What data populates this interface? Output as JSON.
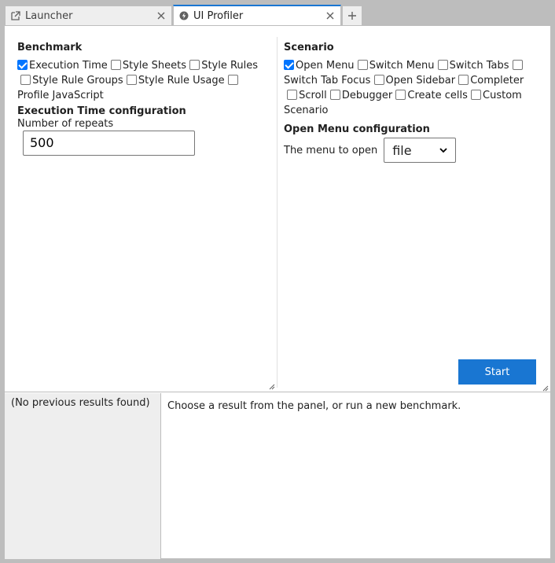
{
  "tabs": [
    {
      "label": "Launcher",
      "icon": "launch-icon",
      "active": false
    },
    {
      "label": "UI Profiler",
      "icon": "lightning-icon",
      "active": true
    }
  ],
  "benchmark": {
    "heading": "Benchmark",
    "options": [
      {
        "label": "Execution Time",
        "checked": true
      },
      {
        "label": "Style Sheets",
        "checked": false
      },
      {
        "label": "Style Rules",
        "checked": false
      },
      {
        "label": "Style Rule Groups",
        "checked": false
      },
      {
        "label": "Style Rule Usage",
        "checked": false
      },
      {
        "label": "Profile JavaScript",
        "checked": false
      }
    ],
    "config_heading": "Execution Time configuration",
    "repeats_label": "Number of repeats",
    "repeats_value": "500"
  },
  "scenario": {
    "heading": "Scenario",
    "options": [
      {
        "label": "Open Menu",
        "checked": true
      },
      {
        "label": "Switch Menu",
        "checked": false
      },
      {
        "label": "Switch Tabs",
        "checked": false
      },
      {
        "label": "Switch Tab Focus",
        "checked": false
      },
      {
        "label": "Open Sidebar",
        "checked": false
      },
      {
        "label": "Completer",
        "checked": false
      },
      {
        "label": "Scroll",
        "checked": false
      },
      {
        "label": "Debugger",
        "checked": false
      },
      {
        "label": "Create cells",
        "checked": false
      },
      {
        "label": "Custom Scenario",
        "checked": false
      }
    ],
    "config_heading": "Open Menu configuration",
    "menu_label": "The menu to open",
    "menu_value": "file"
  },
  "start_label": "Start",
  "results": {
    "empty_text": "(No previous results found)",
    "detail_text": "Choose a result from the panel, or run a new benchmark."
  }
}
